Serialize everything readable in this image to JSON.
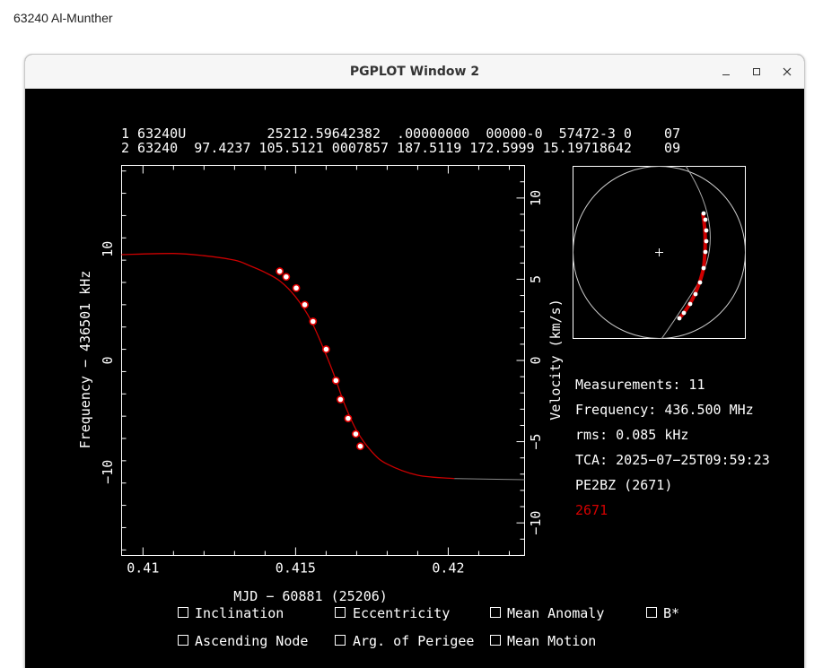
{
  "caption": "63240 Al-Munther",
  "window": {
    "title": "PGPLOT Window 2"
  },
  "tle": {
    "line1": "1 63240U          25212.59642382  .00000000  00000-0  57472-3 0    07",
    "line2": "2 63240  97.4237 105.5121 0007857 187.5119 172.5999 15.19718642    09"
  },
  "plot": {
    "ylabel_left": "Frequency − 436501 kHz",
    "ylabel_right": "Velocity (km/s)",
    "xlabel": "MJD − 60881 (25206)",
    "xticks": [
      {
        "value": 0.41,
        "label": "0.41"
      },
      {
        "value": 0.415,
        "label": "0.415"
      },
      {
        "value": 0.42,
        "label": "0.42"
      }
    ],
    "yticks_left": [
      {
        "value": 10,
        "label": "10"
      },
      {
        "value": 0,
        "label": "0"
      },
      {
        "value": -10,
        "label": "−10"
      }
    ],
    "yticks_right": [
      {
        "value": 10,
        "label": "10"
      },
      {
        "value": 5,
        "label": "5"
      },
      {
        "value": 0,
        "label": "0"
      },
      {
        "value": -5,
        "label": "−5"
      },
      {
        "value": -10,
        "label": "−10"
      }
    ]
  },
  "chart_data": {
    "type": "scatter",
    "xlabel": "MJD − 60881 (25206)",
    "ylabel": "Frequency − 436501 kHz",
    "xlim": [
      0.4093,
      0.4225
    ],
    "ylim": [
      -17.5,
      17.5
    ],
    "curve": {
      "x": [
        0.4093,
        0.411,
        0.412,
        0.413,
        0.4135,
        0.414,
        0.4145,
        0.415,
        0.4155,
        0.416,
        0.4163,
        0.4166,
        0.417,
        0.4175,
        0.418,
        0.419,
        0.4202,
        0.4225
      ],
      "y": [
        9.5,
        9.6,
        9.4,
        9.0,
        8.5,
        7.9,
        7.1,
        5.7,
        3.6,
        0.5,
        -1.6,
        -3.9,
        -6.3,
        -8.2,
        -9.3,
        -10.3,
        -10.6,
        -10.7
      ]
    },
    "measurements": {
      "x": [
        0.41448,
        0.41469,
        0.41502,
        0.4153,
        0.41557,
        0.416,
        0.41632,
        0.41647,
        0.41672,
        0.41697,
        0.41712
      ],
      "y": [
        8.0,
        7.5,
        6.5,
        5.0,
        3.5,
        1.0,
        -1.8,
        -3.5,
        -5.2,
        -6.6,
        -7.7
      ]
    }
  },
  "info": {
    "measurements": "Measurements: 11",
    "frequency": "Frequency: 436.500 MHz",
    "rms": "rms: 0.085 kHz",
    "tca": "TCA: 2025−07−25T09:59:23",
    "station": "PE2BZ (2671)",
    "station_id": "2671"
  },
  "checkboxes": {
    "inclination": "Inclination",
    "eccentricity": "Eccentricity",
    "mean_anomaly": "Mean Anomaly",
    "bstar": "B*",
    "ascending_node": "Ascending Node",
    "arg_perigee": "Arg. of Perigee",
    "mean_motion": "Mean Motion"
  },
  "colors": {
    "curve": "#cc0000",
    "marker_fill": "#ffffff",
    "marker_edge": "#e00000",
    "station_id": "#d40000",
    "foreground": "#ffffff",
    "background": "#000000"
  }
}
